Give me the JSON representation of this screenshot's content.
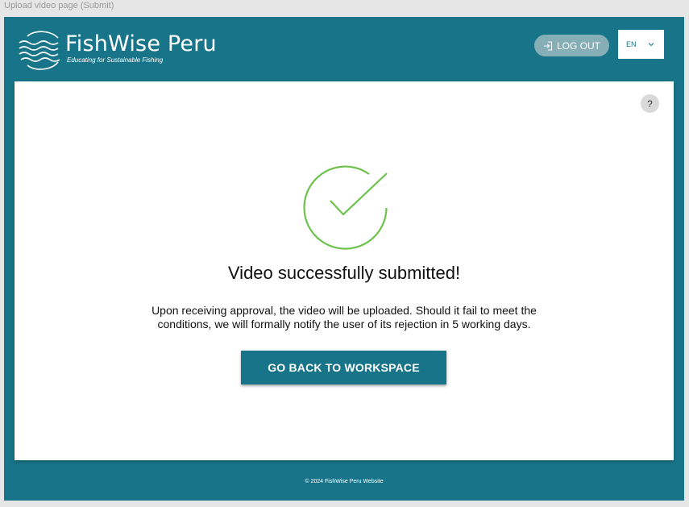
{
  "frame": {
    "label": "Upload video page (Submit)"
  },
  "header": {
    "brand_name": "FishWise Peru",
    "brand_tagline": "Educating for Sustainable Fishing",
    "logout_label": "LOG OUT",
    "language": "EN"
  },
  "card": {
    "help_label": "?",
    "title": "Video successfully submitted!",
    "message": "Upon receiving approval, the video will be uploaded. Should it fail to meet the conditions, we will formally notify the user of its rejection in 5 working days.",
    "button_label": "GO BACK TO WORKSPACE"
  },
  "footer": {
    "copyright": "© 2024 FishWise Peru Website"
  },
  "colors": {
    "brand": "#187589",
    "logout_bg": "#86aeb7",
    "success": "#6cc24a",
    "help_bg": "#d9d9d9"
  },
  "icons": [
    "waves-logo-icon",
    "logout-icon",
    "chevron-down-icon",
    "help-icon",
    "success-check-icon"
  ]
}
